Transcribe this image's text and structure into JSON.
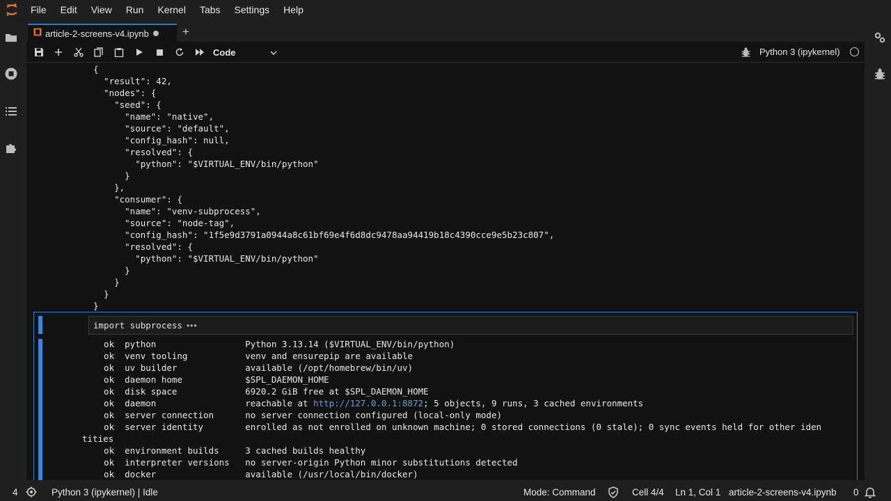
{
  "menubar": {
    "items": [
      "File",
      "Edit",
      "View",
      "Run",
      "Kernel",
      "Tabs",
      "Settings",
      "Help"
    ]
  },
  "left_rail": {
    "icons": [
      "folder-icon",
      "stop-circle-icon",
      "list-icon",
      "puzzle-icon"
    ]
  },
  "right_rail": {
    "icons": [
      "gear-icon",
      "bug-icon"
    ]
  },
  "tab": {
    "label": "article-2-screens-v4.ipynb",
    "add_label": "+"
  },
  "toolbar": {
    "cell_type": "Code",
    "kernel_name": "Python 3 (ipykernel)"
  },
  "previous_output": {
    "lines": [
      "{",
      "  \"result\": 42,",
      "  \"nodes\": {",
      "    \"seed\": {",
      "      \"name\": \"native\",",
      "      \"source\": \"default\",",
      "      \"config_hash\": null,",
      "      \"resolved\": {",
      "        \"python\": \"$VIRTUAL_ENV/bin/python\"",
      "      }",
      "    },",
      "    \"consumer\": {",
      "      \"name\": \"venv-subprocess\",",
      "      \"source\": \"node-tag\",",
      "      \"config_hash\": \"1f5e9d3791a0944a8c61bf69e4f6d8dc9478aa94419b18c4390cce9e5b23c807\",",
      "      \"resolved\": {",
      "        \"python\": \"$VIRTUAL_ENV/bin/python\"",
      "      }",
      "    }",
      "  }",
      "}"
    ]
  },
  "active_cell": {
    "input_code": "import subprocess",
    "ellipsis": "•••",
    "output_lines": [
      "  ok  python                 Python 3.13.14 ($VIRTUAL_ENV/bin/python)",
      "  ok  venv tooling           venv and ensurepip are available",
      "  ok  uv builder             available (/opt/homebrew/bin/uv)",
      "  ok  daemon home            $SPL_DAEMON_HOME",
      "  ok  disk space             6920.2 GiB free at $SPL_DAEMON_HOME",
      "  ok  server connection      no server connection configured (local-only mode)",
      "  ok  server identity        enrolled as not enrolled on unknown machine; 0 stored connections (0 stale); 0 sync events held for other iden",
      "tities",
      "  ok  environment builds     3 cached builds healthy",
      "  ok  interpreter versions   no server-origin Python minor substitutions detected",
      "  ok  docker                 available (/usr/local/bin/docker)"
    ],
    "daemon_line": {
      "prefix": "  ok  daemon                 reachable at ",
      "link": "http://127.0.0.1:8872",
      "suffix": "; 5 objects, 9 runs, 3 cached environments"
    }
  },
  "statusbar": {
    "terminal_count": "4",
    "kernel_status": "Python 3 (ipykernel) | Idle",
    "mode": "Mode: Command",
    "cell_position": "Cell 4/4",
    "cursor_position": "Ln 1, Col 1",
    "file_name": "article-2-screens-v4.ipynb",
    "notification_count": "0"
  },
  "colors": {
    "accent": "#2f89e8",
    "link": "#5aa0e6",
    "logo": "#e46e2e"
  }
}
